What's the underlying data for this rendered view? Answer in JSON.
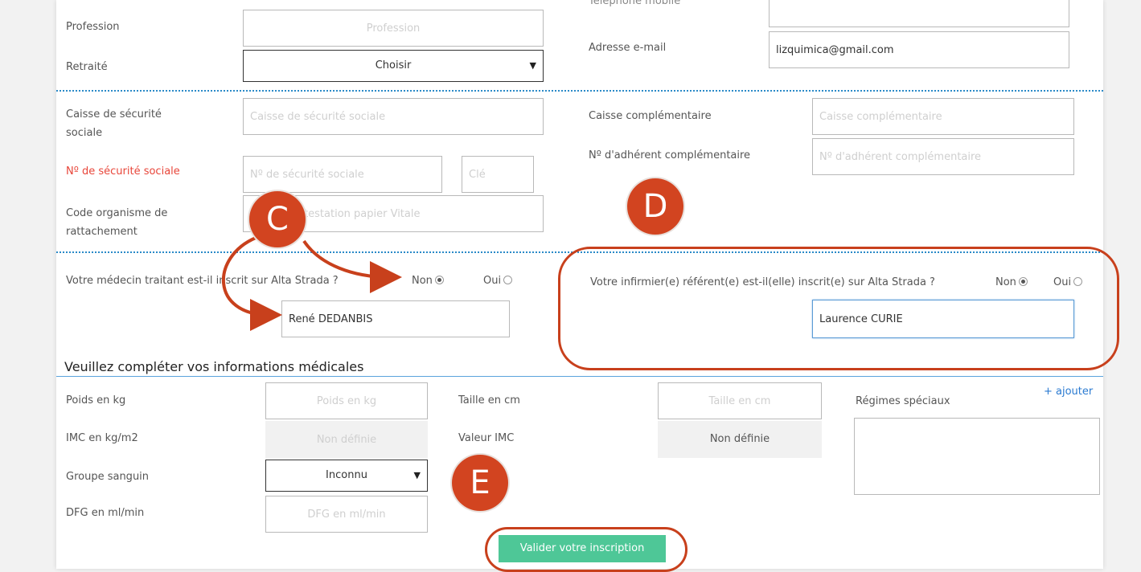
{
  "personal": {
    "profession_label": "Profession",
    "profession_placeholder": "Profession",
    "profession_value": "",
    "retired_label": "Retraité",
    "retired_value": "Choisir",
    "mobile_label": "Téléphone mobile",
    "mobile_value": "",
    "email_label": "Adresse e-mail",
    "email_value": "lizquimica@gmail.com"
  },
  "insurance": {
    "social_security_fund_label": "Caisse de sécurité sociale",
    "social_security_fund_placeholder": "Caisse de sécurité sociale",
    "complementary_fund_label": "Caisse complémentaire",
    "complementary_fund_placeholder": "Caisse complémentaire",
    "complementary_member_label": "Nº d'adhérent complémentaire",
    "complementary_member_placeholder": "Nº d'adhérent complémentaire",
    "social_security_number_label": "Nº de sécurité sociale",
    "social_security_number_placeholder": "Nº de sécurité sociale",
    "key_placeholder": "Clé",
    "organism_code_label": "Code organisme de rattachement",
    "organism_code_placeholder": "attestation papier Vitale"
  },
  "referents": {
    "doctor_question": "Votre médecin traitant est-il inscrit sur Alta Strada ?",
    "doctor_question_visible": "Votre médecin traitant est-il inscrit sur Alta Strada ?",
    "doctor_non_label": "Non",
    "doctor_oui_label": "Oui",
    "doctor_selected": "Non",
    "doctor_name": "René DEDANBIS",
    "nurse_question": "Votre infirmier(e) référent(e) est-il(elle) inscrit(e) sur Alta Strada ?",
    "nurse_non_label": "Non",
    "nurse_oui_label": "Oui",
    "nurse_selected": "Non",
    "nurse_name": "Laurence CURIE"
  },
  "medical": {
    "section_title": "Veuillez compléter vos informations médicales",
    "weight_label": "Poids en kg",
    "weight_placeholder": "Poids en kg",
    "height_label": "Taille en cm",
    "height_placeholder": "Taille en cm",
    "special_diets_label": "Régimes spéciaux",
    "add_label": "+ ajouter",
    "bmi_label": "IMC en kg/m2",
    "bmi_placeholder": "Non définie",
    "bmi_value_label": "Valeur IMC",
    "bmi_value": "Non définie",
    "blood_group_label": "Groupe sanguin",
    "blood_group_value": "Inconnu",
    "gfr_label": "DFG en ml/min",
    "gfr_placeholder": "DFG en ml/min"
  },
  "actions": {
    "submit_label": "Valider votre inscription"
  },
  "annotations": {
    "badge_c": "C",
    "badge_d": "D",
    "badge_e": "E",
    "accent_color": "#d24420"
  },
  "colors": {
    "dotted_separator": "#2a8ac8",
    "submit_button": "#4ec797",
    "required_label": "#e8463a",
    "link": "#2a7ad1"
  }
}
